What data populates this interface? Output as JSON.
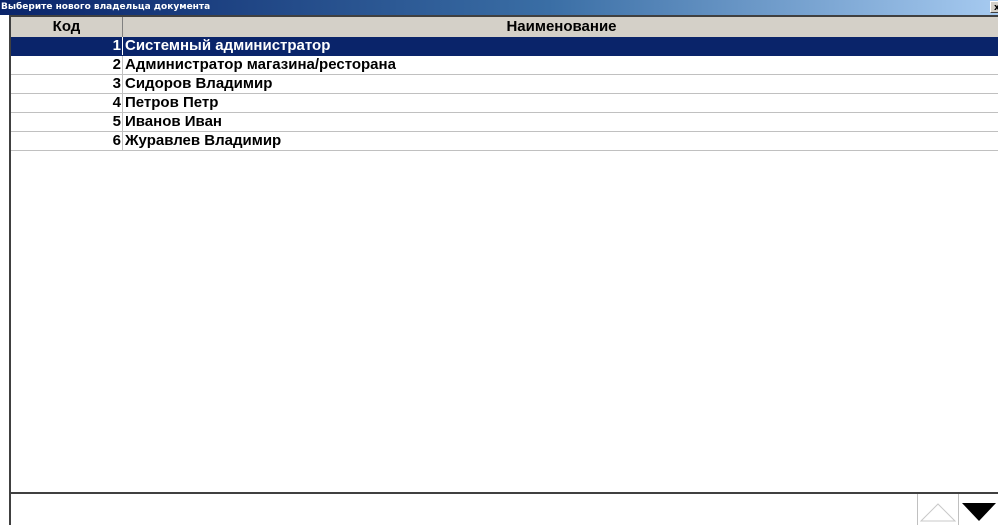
{
  "window": {
    "title": "Выберите нового владельца документа",
    "close_glyph": "x"
  },
  "table": {
    "columns": {
      "code": "Код",
      "name": "Наименование"
    },
    "selected_row": 0,
    "rows": [
      {
        "code": "1",
        "name": "Системный администратор"
      },
      {
        "code": "2",
        "name": "Администратор магазина/ресторана"
      },
      {
        "code": "3",
        "name": "Сидоров Владимир"
      },
      {
        "code": "4",
        "name": "Петров Петр"
      },
      {
        "code": "5",
        "name": "Иванов Иван"
      },
      {
        "code": "6",
        "name": "Журавлев Владимир"
      }
    ]
  },
  "navigation": {
    "up_icon": "triangle-up-icon",
    "down_icon": "triangle-down-icon",
    "up_enabled": false,
    "down_enabled": true
  }
}
